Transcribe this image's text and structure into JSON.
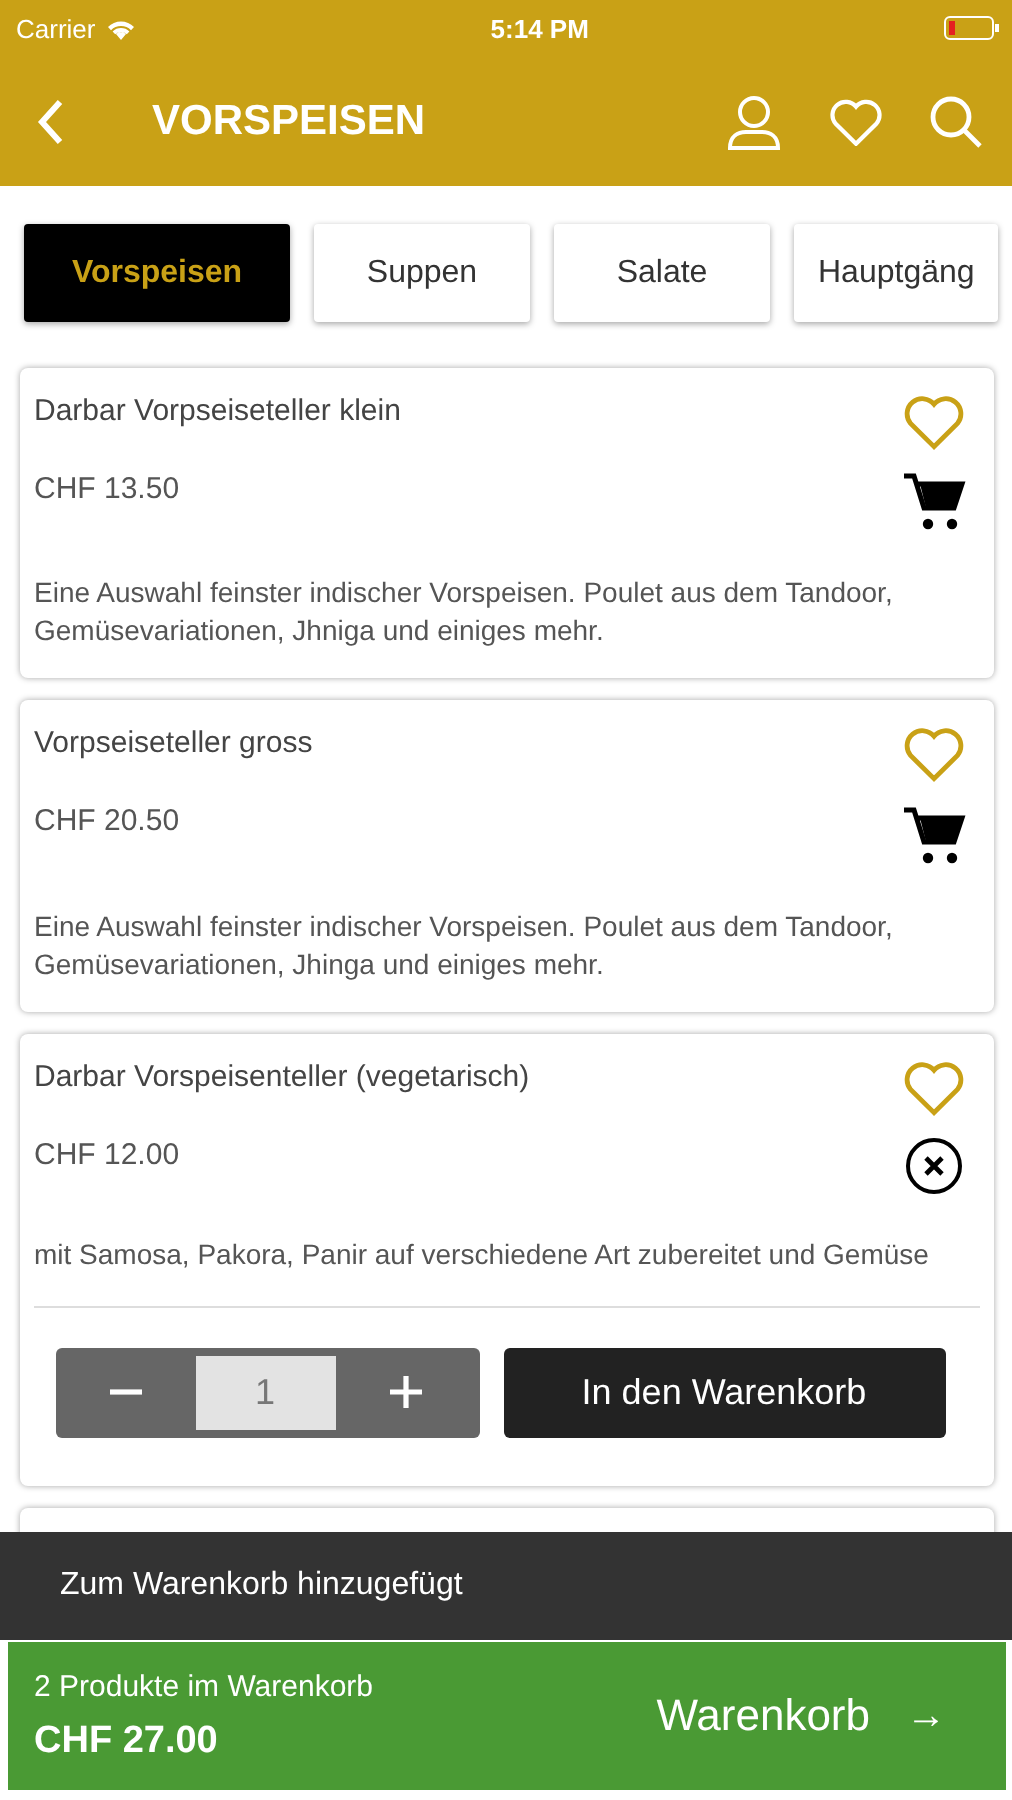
{
  "status_bar": {
    "carrier": "Carrier",
    "time": "5:14 PM"
  },
  "nav": {
    "title": "VORSPEISEN"
  },
  "tabs": [
    {
      "label": "Vorspeisen",
      "selected": true
    },
    {
      "label": "Suppen",
      "selected": false
    },
    {
      "label": "Salate",
      "selected": false
    },
    {
      "label": "Hauptgäng",
      "selected": false
    }
  ],
  "items": [
    {
      "name": "Darbar Vorpseiseteller klein",
      "price": "CHF 13.50",
      "description": "Eine Auswahl feinster indischer Vorspeisen. Poulet aus dem Tandoor, Gemüsevariationen, Jhniga und einiges mehr.",
      "expanded": false
    },
    {
      "name": "Vorpseiseteller gross",
      "price": "CHF 20.50",
      "description": "Eine Auswahl feinster indischer Vorspeisen. Poulet aus dem Tandoor, Gemüsevariationen, Jhinga und einiges mehr.",
      "expanded": false
    },
    {
      "name": "Darbar Vorspeisenteller (vegetarisch)",
      "price": "CHF 12.00",
      "description": "mit Samosa, Pakora, Panir auf verschiedene Art zubereitet und Gemüse",
      "expanded": true,
      "quantity": "1",
      "add_button": "In den Warenkorb"
    }
  ],
  "snackbar": {
    "message": "Zum Warenkorb hinzugefügt"
  },
  "cart_bar": {
    "count": "2 Produkte im Warenkorb",
    "total": "CHF 27.00",
    "button": "Warenkorb",
    "arrow": "→"
  }
}
